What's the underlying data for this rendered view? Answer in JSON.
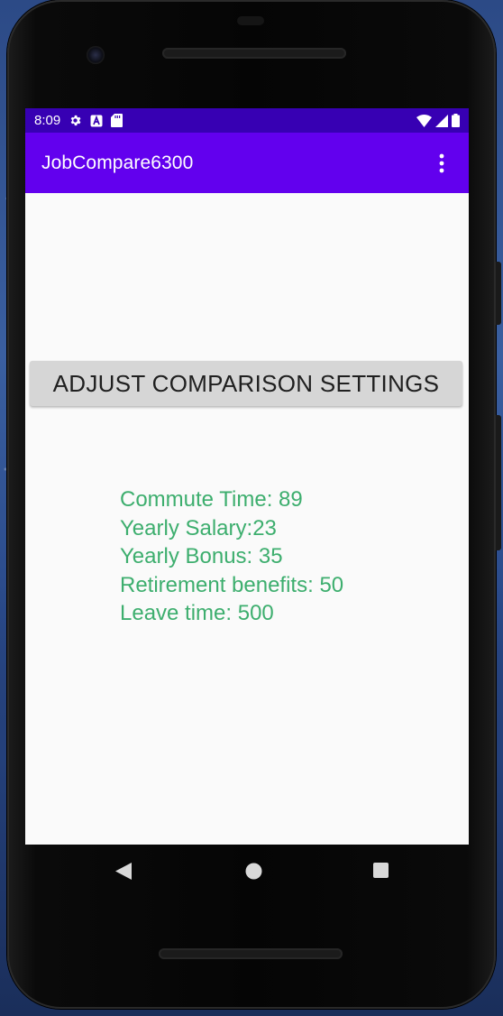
{
  "status_bar": {
    "time": "8:09",
    "icons": [
      "settings-icon",
      "a-letter-icon",
      "sd-card-icon",
      "wifi-icon",
      "signal-icon",
      "battery-icon"
    ]
  },
  "app_bar": {
    "title": "JobCompare6300",
    "overflow_icon": "more-vert-icon"
  },
  "main": {
    "adjust_button_label": "ADJUST COMPARISON SETTINGS",
    "settings_lines": [
      "Commute Time: 89",
      "Yearly Salary:23",
      "Yearly Bonus: 35",
      "Retirement benefits: 50",
      "Leave time: 500"
    ]
  },
  "nav_bar": {
    "buttons": [
      "back-icon",
      "home-icon",
      "recents-icon"
    ]
  },
  "colors": {
    "status_bar": "#3700b3",
    "app_bar": "#6200ee",
    "settings_text": "#3dae6e",
    "button_bg": "#d6d6d6",
    "screen_bg": "#fafafa"
  }
}
